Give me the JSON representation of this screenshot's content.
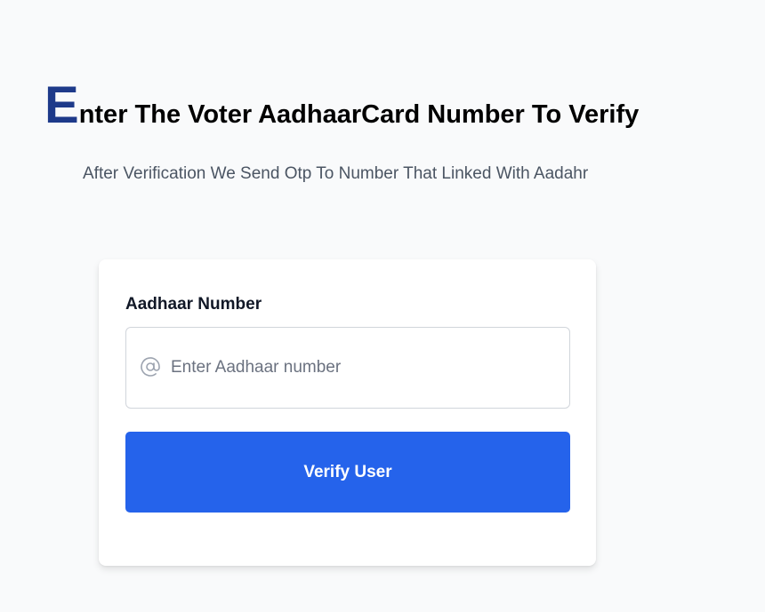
{
  "header": {
    "drop_cap": "E",
    "title_rest": "nter The Voter AadhaarCard Number To Verify",
    "subtitle": "After Verification We Send Otp To Number That Linked With Aadahr"
  },
  "form": {
    "label": "Aadhaar Number",
    "input": {
      "value": "",
      "placeholder": "Enter Aadhaar number",
      "icon": "at-icon"
    },
    "submit_label": "Verify User"
  },
  "colors": {
    "background": "#f9fafb",
    "drop_cap": "#1e3a8a",
    "button": "#2563eb",
    "subtitle": "#4b5563",
    "icon": "#9ca3af"
  }
}
